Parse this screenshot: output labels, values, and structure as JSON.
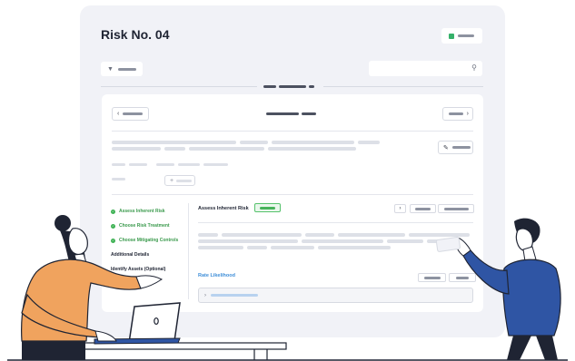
{
  "page": {
    "title": "Risk No. 04"
  },
  "steps": [
    {
      "label": "Assess Inherent Risk",
      "done": true
    },
    {
      "label": "Choose Risk Treatment",
      "done": true
    },
    {
      "label": "Choose Mitigating Controls",
      "done": true
    },
    {
      "label": "Additional Details",
      "done": false
    },
    {
      "label": "Identify Assets (Optional)",
      "done": false
    }
  ],
  "section": {
    "title": "Assess Inherent Risk"
  },
  "rating": {
    "label": "Rate Likelihood"
  },
  "icons": {
    "filter": "filter-icon",
    "search": "search-icon",
    "prev": "chevron-left-icon",
    "next": "chevron-right-icon",
    "edit": "pencil-icon",
    "add": "plus-icon",
    "check": "check-icon",
    "expand": "chevron-right-icon"
  },
  "colors": {
    "accent_green": "#35b16a",
    "link_blue": "#3e8ed8",
    "shirt_orange": "#f0a35e",
    "shirt_blue": "#2f55a4",
    "background": "#f1f2f7"
  }
}
